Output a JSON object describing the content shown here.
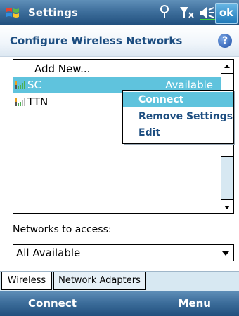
{
  "titlebar": {
    "title": "Settings",
    "ok_label": "ok",
    "icons": [
      "start-flag-icon",
      "connectivity-icon",
      "signal-off-icon",
      "speaker-icon"
    ]
  },
  "header": {
    "title": "Configure Wireless Networks",
    "help_symbol": "?"
  },
  "network_list": {
    "add_new_label": "Add New...",
    "networks": [
      {
        "ssid": "SC",
        "status": "Available",
        "selected": true
      },
      {
        "ssid": "TTN",
        "status": "",
        "selected": false
      }
    ]
  },
  "context_menu": {
    "items": [
      {
        "label": "Connect",
        "highlighted": true
      },
      {
        "label": "Remove Settings",
        "highlighted": false
      },
      {
        "label": "Edit",
        "highlighted": false
      }
    ]
  },
  "access": {
    "label": "Networks to access:",
    "selected_value": "All Available"
  },
  "tabs": [
    {
      "label": "Wireless",
      "active": true
    },
    {
      "label": "Network Adapters",
      "active": false
    }
  ],
  "softkeys": {
    "left": "Connect",
    "right": "Menu"
  },
  "colors": {
    "accent": "#1c4d80",
    "selection": "#5fc3dd",
    "bar": "#3e6f9c"
  }
}
